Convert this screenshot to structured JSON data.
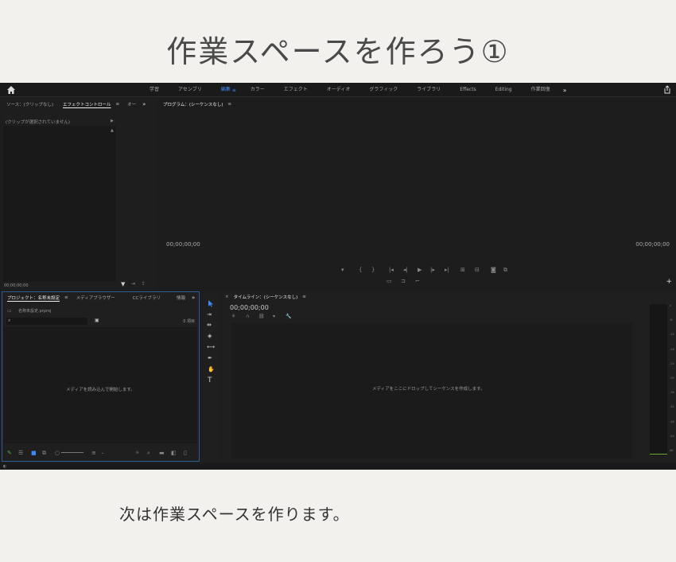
{
  "page": {
    "title": "作業スペースを作ろう①",
    "caption": "次は作業スペースを作ります。"
  },
  "colors": {
    "accent": "#3d8bf5",
    "app_bg": "#1d1d1d",
    "page_bg": "#f3f1ed"
  },
  "topbar": {
    "home_icon": "home-icon",
    "tabs": [
      {
        "label": "学習"
      },
      {
        "label": "アセンブリ"
      },
      {
        "label": "編集",
        "active": true
      },
      {
        "label": "カラー"
      },
      {
        "label": "エフェクト"
      },
      {
        "label": "オーディオ"
      },
      {
        "label": "グラフィック"
      },
      {
        "label": "ライブラリ"
      },
      {
        "label": "Effects"
      },
      {
        "label": "Editing"
      },
      {
        "label": "作業回復"
      }
    ],
    "menu_glyph": "≡",
    "more_glyph": "»",
    "share_icon": "share-icon"
  },
  "source_panel": {
    "tab_source": "ソース：(クリップなし)",
    "tab_effects": "エフェクトコントロール",
    "tab_audio": "オー",
    "menu_glyph": "≡",
    "more_glyph": "»",
    "clip_msg": "(クリップが選択されていません)",
    "timecode": "00;00;00;00"
  },
  "program_panel": {
    "tab_label": "プログラム：(シーケンスなし)",
    "menu_glyph": "≡",
    "timecode_left": "00;00;00;00",
    "timecode_right": "00;00;00;00"
  },
  "project_panel": {
    "tab_project": "プロジェクト：名称未設定",
    "tab_media": "メディアブラウザー",
    "tab_library": "CCライブラリ",
    "tab_info": "情報",
    "menu_glyph": "≡",
    "more_glyph": "»",
    "file_name": "名称未設定.prproj",
    "search_placeholder": "",
    "item_count": "0 項目",
    "empty_msg": "メディアを読み込んで開始します。"
  },
  "timeline_panel": {
    "close_glyph": "×",
    "tab_label": "タイムライン：(シーケンスなし)",
    "menu_glyph": "≡",
    "timecode": "00;00;00;00",
    "drop_msg": "メディアをここにドロップしてシーケンスを作成します。"
  },
  "tools_panel": {
    "tools": [
      "selection-tool-icon",
      "track-select-tool-icon",
      "ripple-edit-tool-icon",
      "razor-tool-icon",
      "slip-tool-icon",
      "pen-tool-icon",
      "hand-tool-icon",
      "type-tool-icon"
    ]
  },
  "audio_meter": {
    "labels": [
      "0",
      "-6",
      "-12",
      "-18",
      "-24",
      "-30",
      "-36",
      "-42",
      "-48",
      "-54",
      "dB"
    ]
  }
}
